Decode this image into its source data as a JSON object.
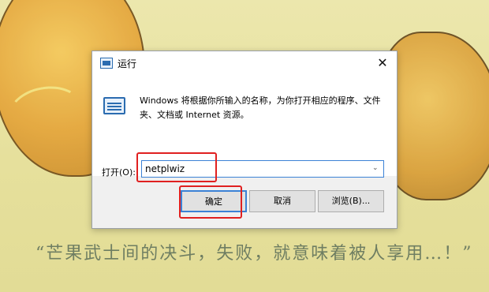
{
  "dialog": {
    "title": "运行",
    "close": "✕",
    "description": "Windows 将根据你所输入的名称，为你打开相应的程序、文件夹、文档或 Internet 资源。",
    "open_label": "打开(O):",
    "command_value": "netplwiz",
    "ok_label": "确定",
    "cancel_label": "取消",
    "browse_label": "浏览(B)..."
  },
  "wallpaper": {
    "quote": "“芒果武士间的决斗，失败，就意味着被人享用…！”"
  },
  "colors": {
    "highlight": "#e02020",
    "accent": "#3c82d6"
  },
  "icons": {
    "title": "run-icon",
    "content": "run-icon",
    "dropdown": "chevron-down-icon"
  }
}
